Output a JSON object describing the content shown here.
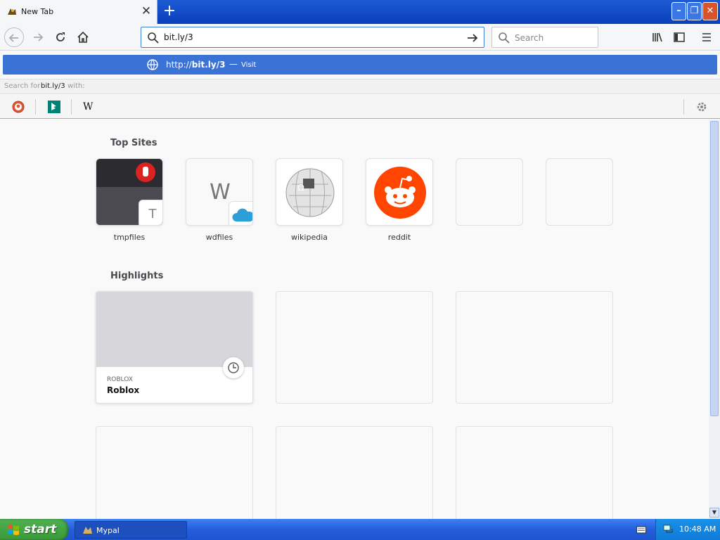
{
  "tab": {
    "title": "New Tab",
    "close": "✕",
    "new_tab": "+"
  },
  "window_controls": {
    "minimize": "–",
    "maximize": "❐",
    "close": "✕"
  },
  "nav": {
    "url_value": "bit.ly/3",
    "search_placeholder": "Search"
  },
  "autocomplete": {
    "url_prefix": "http://",
    "url_bold": "bit.ly",
    "url_suffix": "/3",
    "separator": "—",
    "action": "Visit",
    "search_for_prefix": "Search for",
    "search_for_term": "bit.ly/3",
    "search_for_suffix": "with:"
  },
  "engines": [
    {
      "name": "duckduckgo",
      "icon": "duckduckgo-icon"
    },
    {
      "name": "bing",
      "icon": "bing-icon"
    },
    {
      "name": "wikipedia",
      "icon": "wikipedia-icon",
      "glyph": "W"
    }
  ],
  "top_sites": {
    "heading": "Top Sites",
    "items": [
      {
        "label": "tmpfiles",
        "letter": "T"
      },
      {
        "label": "wdfiles",
        "letter": "W"
      },
      {
        "label": "wikipedia",
        "letter": "Ω"
      },
      {
        "label": "reddit"
      },
      {
        "label": ""
      },
      {
        "label": ""
      }
    ]
  },
  "highlights": {
    "heading": "Highlights",
    "cards": [
      {
        "host": "ROBLOX",
        "title": "Roblox"
      }
    ]
  },
  "taskbar": {
    "start": "start",
    "task_label": "Mypal",
    "time": "10:48 AM"
  },
  "colors": {
    "accent": "#3b72d5",
    "reddit": "#ff4500",
    "taskbar": "#245edb",
    "start": "#3a9a3a"
  }
}
